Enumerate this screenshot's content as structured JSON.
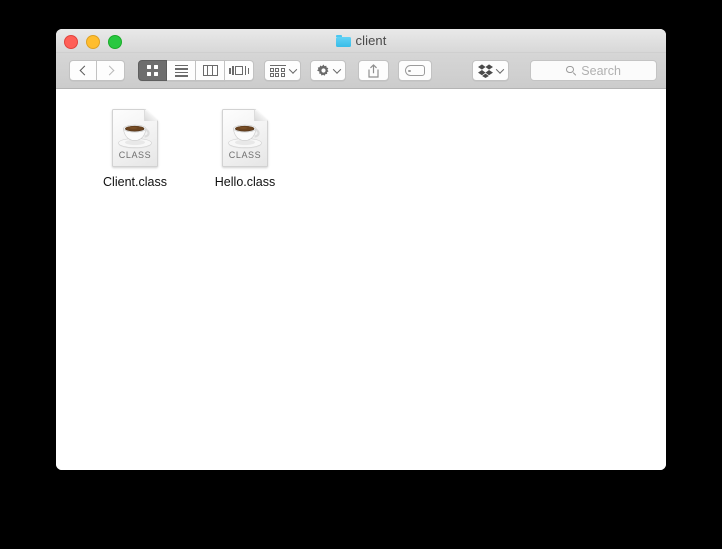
{
  "window": {
    "title": "client",
    "title_icon": "folder-icon",
    "folder_color": "#4cc7f0",
    "traffic_lights": [
      {
        "name": "close",
        "color": "#ff5f57"
      },
      {
        "name": "minimize",
        "color": "#ffbd2e"
      },
      {
        "name": "zoom",
        "color": "#28c840"
      }
    ]
  },
  "toolbar": {
    "back_label": "Back",
    "forward_label": "Forward",
    "back_icon": "chevron-left-icon",
    "forward_icon": "chevron-right-icon",
    "view_modes": [
      {
        "id": "icon",
        "label": "Icon View",
        "icon": "grid-icon",
        "active": true
      },
      {
        "id": "list",
        "label": "List View",
        "icon": "list-icon",
        "active": false
      },
      {
        "id": "column",
        "label": "Column View",
        "icon": "columns-icon",
        "active": false
      },
      {
        "id": "gallery",
        "label": "Cover Flow",
        "icon": "coverflow-icon",
        "active": false
      }
    ],
    "arrange": {
      "label": "Arrange By",
      "icon": "arrange-icon",
      "chevron": "chevron-down-icon"
    },
    "action": {
      "label": "Action",
      "icon": "gear-icon",
      "chevron": "chevron-down-icon"
    },
    "share": {
      "label": "Share",
      "icon": "share-icon"
    },
    "tag": {
      "label": "Edit Tags",
      "icon": "tag-icon"
    },
    "dropbox": {
      "label": "Dropbox",
      "icon": "dropbox-icon",
      "chevron": "chevron-down-icon"
    }
  },
  "search": {
    "placeholder": "Search",
    "value": "",
    "icon": "search-icon"
  },
  "files": [
    {
      "name": "Client.class",
      "type": "java-class-file",
      "badge": "CLASS",
      "icon": "coffee-cup-document-icon"
    },
    {
      "name": "Hello.class",
      "type": "java-class-file",
      "badge": "CLASS",
      "icon": "coffee-cup-document-icon"
    }
  ]
}
